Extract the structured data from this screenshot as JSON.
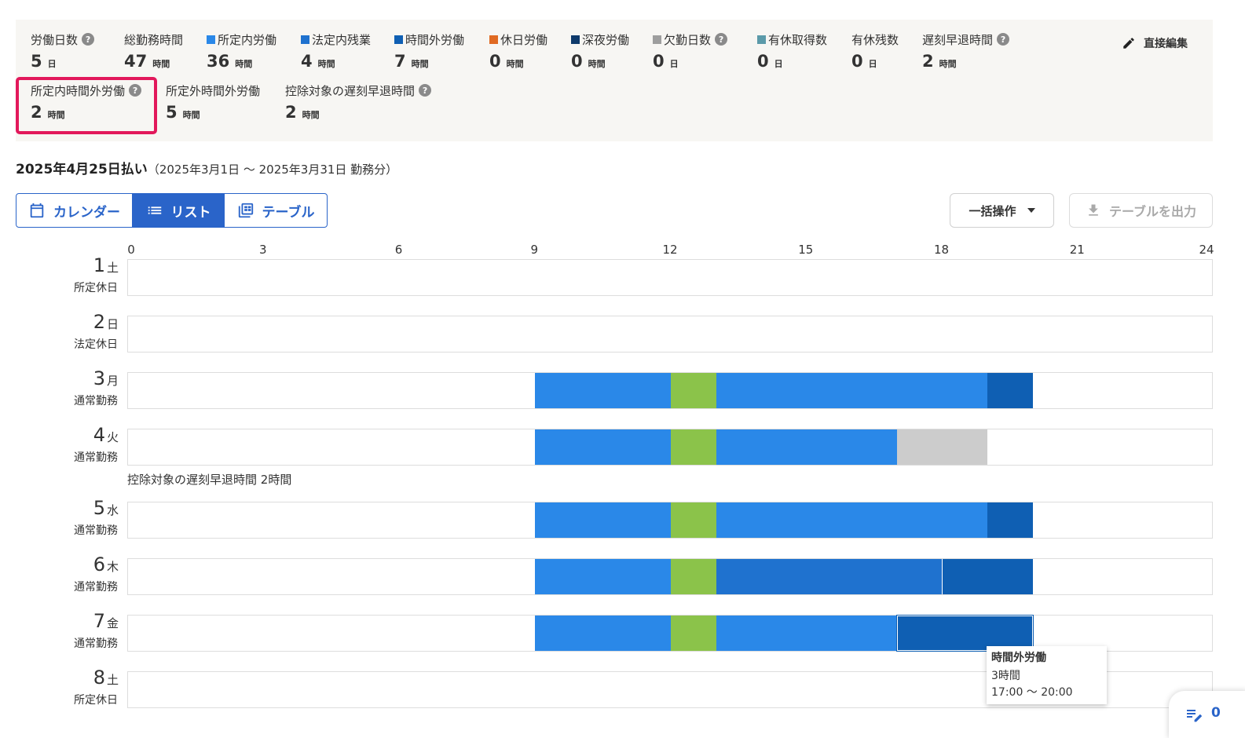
{
  "summary": {
    "stats": [
      {
        "label": "労働日数",
        "value": "5",
        "unit": "日",
        "help": true,
        "color": null
      },
      {
        "label": "総勤務時間",
        "value": "47",
        "unit": "時間",
        "help": false,
        "color": null
      },
      {
        "label": "所定内労働",
        "value": "36",
        "unit": "時間",
        "help": false,
        "color": "#2a88e8"
      },
      {
        "label": "法定内残業",
        "value": "4",
        "unit": "時間",
        "help": false,
        "color": "#1f72cf"
      },
      {
        "label": "時間外労働",
        "value": "7",
        "unit": "時間",
        "help": false,
        "color": "#0f5fb3"
      },
      {
        "label": "休日労働",
        "value": "0",
        "unit": "時間",
        "help": false,
        "color": "#e06a22"
      },
      {
        "label": "深夜労働",
        "value": "0",
        "unit": "時間",
        "help": false,
        "color": "#0e3a6b"
      },
      {
        "label": "欠勤日数",
        "value": "0",
        "unit": "日",
        "help": true,
        "color": "#9e9e9e"
      },
      {
        "label": "有休取得数",
        "value": "0",
        "unit": "日",
        "help": false,
        "color": "#5b9aa9"
      },
      {
        "label": "有休残数",
        "value": "0",
        "unit": "日",
        "help": false,
        "color": null
      },
      {
        "label": "遅刻早退時間",
        "value": "2",
        "unit": "時間",
        "help": true,
        "color": null
      },
      {
        "label": "所定内時間外労働",
        "value": "2",
        "unit": "時間",
        "help": true,
        "color": null
      },
      {
        "label": "所定外時間外労働",
        "value": "5",
        "unit": "時間",
        "help": false,
        "color": null
      },
      {
        "label": "控除対象の遅刻早退時間",
        "value": "2",
        "unit": "時間",
        "help": true,
        "color": null
      }
    ],
    "direct_edit_label": "直接編集",
    "highlight_color": "#e2185b"
  },
  "payday": {
    "title": "2025年4月25日払い",
    "range": "（2025年3月1日 〜 2025年3月31日 勤務分）"
  },
  "view_toggle": {
    "calendar_label": "カレンダー",
    "list_label": "リスト",
    "table_label": "テーブル",
    "active": "list"
  },
  "actions": {
    "bulk_label": "一括操作",
    "export_label": "テーブルを出力"
  },
  "timeline": {
    "hour_ticks": [
      "0",
      "3",
      "6",
      "9",
      "12",
      "15",
      "18",
      "21",
      "24"
    ],
    "colors": {
      "regular": "#2a88e8",
      "break": "#8bc34a",
      "legal_overtime": "#1f72cf",
      "overtime": "#0f5fb3",
      "early_leave": "#cccccc"
    },
    "days": [
      {
        "day": "1",
        "dow": "土",
        "type": "所定休日",
        "segments": [],
        "note": ""
      },
      {
        "day": "2",
        "dow": "日",
        "type": "法定休日",
        "segments": [],
        "note": ""
      },
      {
        "day": "3",
        "dow": "月",
        "type": "通常勤務",
        "segments": [
          {
            "kind": "regular",
            "start": 9,
            "end": 12
          },
          {
            "kind": "break",
            "start": 12,
            "end": 13
          },
          {
            "kind": "regular",
            "start": 13,
            "end": 19
          },
          {
            "kind": "overtime",
            "start": 19,
            "end": 20
          }
        ],
        "note": ""
      },
      {
        "day": "4",
        "dow": "火",
        "type": "通常勤務",
        "segments": [
          {
            "kind": "regular",
            "start": 9,
            "end": 12
          },
          {
            "kind": "break",
            "start": 12,
            "end": 13
          },
          {
            "kind": "regular",
            "start": 13,
            "end": 17
          },
          {
            "kind": "early_leave",
            "start": 17,
            "end": 19
          }
        ],
        "note": "控除対象の遅刻早退時間 2時間"
      },
      {
        "day": "5",
        "dow": "水",
        "type": "通常勤務",
        "segments": [
          {
            "kind": "regular",
            "start": 9,
            "end": 12
          },
          {
            "kind": "break",
            "start": 12,
            "end": 13
          },
          {
            "kind": "regular",
            "start": 13,
            "end": 19
          },
          {
            "kind": "overtime",
            "start": 19,
            "end": 20
          }
        ],
        "note": ""
      },
      {
        "day": "6",
        "dow": "木",
        "type": "通常勤務",
        "segments": [
          {
            "kind": "regular",
            "start": 9,
            "end": 12
          },
          {
            "kind": "break",
            "start": 12,
            "end": 13
          },
          {
            "kind": "legal_overtime",
            "start": 13,
            "end": 18
          },
          {
            "kind": "overtime",
            "start": 18,
            "end": 20
          }
        ],
        "note": ""
      },
      {
        "day": "7",
        "dow": "金",
        "type": "通常勤務",
        "segments": [
          {
            "kind": "regular",
            "start": 9,
            "end": 12
          },
          {
            "kind": "break",
            "start": 12,
            "end": 13
          },
          {
            "kind": "regular",
            "start": 13,
            "end": 17
          },
          {
            "kind": "overtime",
            "start": 17,
            "end": 20,
            "selected": true
          }
        ],
        "note": ""
      },
      {
        "day": "8",
        "dow": "土",
        "type": "所定休日",
        "segments": [],
        "note": ""
      }
    ]
  },
  "tooltip": {
    "title": "時間外労働",
    "duration": "3時間",
    "range": "17:00 〜 20:00"
  },
  "fab": {
    "count": "0"
  }
}
